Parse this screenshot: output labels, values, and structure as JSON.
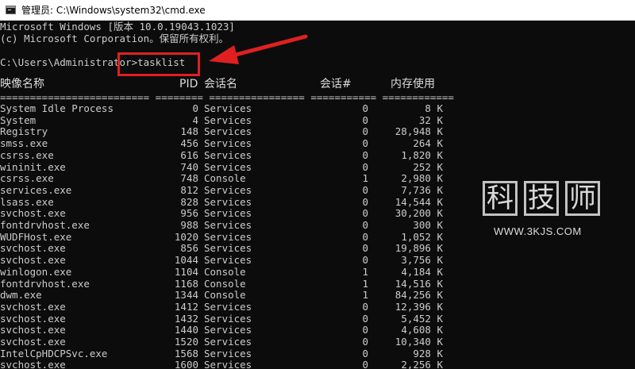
{
  "window": {
    "title": "管理员: C:\\Windows\\system32\\cmd.exe",
    "icon": "cmd-icon"
  },
  "console": {
    "version_line": "Microsoft Windows [版本 10.0.19043.1023]",
    "copyright_line": "(c) Microsoft Corporation。保留所有权利。",
    "prompt": "C:\\Users\\Administrator>",
    "command": "tasklist",
    "headers": {
      "name": "映像名称",
      "pid": "PID",
      "session_name": "会话名",
      "session_num": "会话#",
      "mem_usage": "内存使用"
    },
    "separator": "========================= ======== ================ =========== ============",
    "processes": [
      {
        "name": "System Idle Process",
        "pid": "0",
        "session": "Services",
        "num": "0",
        "mem": "8 K"
      },
      {
        "name": "System",
        "pid": "4",
        "session": "Services",
        "num": "0",
        "mem": "32 K"
      },
      {
        "name": "Registry",
        "pid": "148",
        "session": "Services",
        "num": "0",
        "mem": "28,948 K"
      },
      {
        "name": "smss.exe",
        "pid": "456",
        "session": "Services",
        "num": "0",
        "mem": "264 K"
      },
      {
        "name": "csrss.exe",
        "pid": "616",
        "session": "Services",
        "num": "0",
        "mem": "1,820 K"
      },
      {
        "name": "wininit.exe",
        "pid": "740",
        "session": "Services",
        "num": "0",
        "mem": "252 K"
      },
      {
        "name": "csrss.exe",
        "pid": "748",
        "session": "Console",
        "num": "1",
        "mem": "2,980 K"
      },
      {
        "name": "services.exe",
        "pid": "812",
        "session": "Services",
        "num": "0",
        "mem": "7,736 K"
      },
      {
        "name": "lsass.exe",
        "pid": "828",
        "session": "Services",
        "num": "0",
        "mem": "14,544 K"
      },
      {
        "name": "svchost.exe",
        "pid": "956",
        "session": "Services",
        "num": "0",
        "mem": "30,200 K"
      },
      {
        "name": "fontdrvhost.exe",
        "pid": "988",
        "session": "Services",
        "num": "0",
        "mem": "300 K"
      },
      {
        "name": "WUDFHost.exe",
        "pid": "1020",
        "session": "Services",
        "num": "0",
        "mem": "1,052 K"
      },
      {
        "name": "svchost.exe",
        "pid": "856",
        "session": "Services",
        "num": "0",
        "mem": "19,896 K"
      },
      {
        "name": "svchost.exe",
        "pid": "1044",
        "session": "Services",
        "num": "0",
        "mem": "3,756 K"
      },
      {
        "name": "winlogon.exe",
        "pid": "1104",
        "session": "Console",
        "num": "1",
        "mem": "4,184 K"
      },
      {
        "name": "fontdrvhost.exe",
        "pid": "1168",
        "session": "Console",
        "num": "1",
        "mem": "14,516 K"
      },
      {
        "name": "dwm.exe",
        "pid": "1344",
        "session": "Console",
        "num": "1",
        "mem": "84,256 K"
      },
      {
        "name": "svchost.exe",
        "pid": "1412",
        "session": "Services",
        "num": "0",
        "mem": "12,396 K"
      },
      {
        "name": "svchost.exe",
        "pid": "1432",
        "session": "Services",
        "num": "0",
        "mem": "5,452 K"
      },
      {
        "name": "svchost.exe",
        "pid": "1440",
        "session": "Services",
        "num": "0",
        "mem": "4,608 K"
      },
      {
        "name": "svchost.exe",
        "pid": "1520",
        "session": "Services",
        "num": "0",
        "mem": "10,340 K"
      },
      {
        "name": "IntelCpHDCPSvc.exe",
        "pid": "1568",
        "session": "Services",
        "num": "0",
        "mem": "928 K"
      },
      {
        "name": "svchost.exe",
        "pid": "1600",
        "session": "Services",
        "num": "0",
        "mem": "2,256 K"
      }
    ]
  },
  "annotation": {
    "highlight_color": "#e02020"
  },
  "watermark": {
    "chars": [
      "科",
      "技",
      "师"
    ],
    "url": "WWW.3KJS.COM"
  }
}
